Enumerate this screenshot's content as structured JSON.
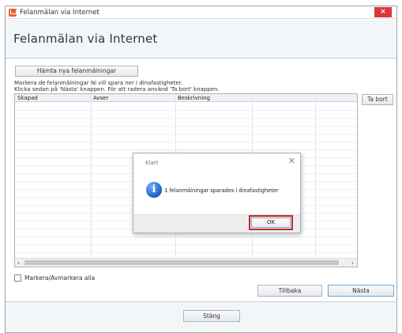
{
  "window": {
    "title": "Felanmälan via Internet",
    "close_glyph": "×"
  },
  "header": {
    "title": "Felanmälan via Internet"
  },
  "toolbar": {
    "fetch_label": "Hämta nya felanmälningar"
  },
  "instructions": {
    "line1": "Markera de felanmälningar Ni vill spara ner i dinafastigheter.",
    "line2": "Klicka sedan på 'Nästa' knappen. För att radera använd 'Ta bort' knappen."
  },
  "table": {
    "columns": [
      "Skapad",
      "Avser",
      "Beskrivning"
    ]
  },
  "scrollbar": {
    "left_glyph": "‹",
    "right_glyph": "›"
  },
  "actions": {
    "delete_label": "Ta bort",
    "select_all_label": "Markera/Avmarkera alla",
    "back_label": "Tillbaka",
    "next_label": "Nästa",
    "close_label": "Stäng"
  },
  "dialog": {
    "title": "Klart",
    "close_glyph": "✕",
    "icon_glyph": "i",
    "message": "1 felanmälningar sparades i dinafastigheter",
    "ok_label": "OK"
  },
  "colors": {
    "close_button": "#d83a3a",
    "info_icon": "#1a5fc4",
    "ok_highlight": "#c62828"
  }
}
